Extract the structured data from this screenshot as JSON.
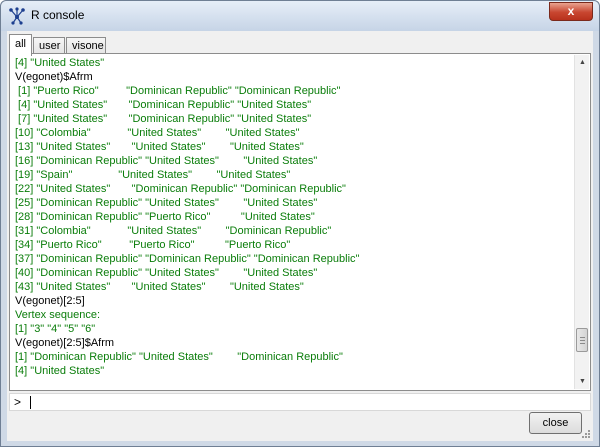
{
  "window": {
    "title": "R console",
    "close_glyph": "x",
    "icon": "network-graph-icon"
  },
  "tabs": [
    {
      "label": "all",
      "active": true
    },
    {
      "label": "user",
      "active": false
    },
    {
      "label": "visone",
      "active": false
    }
  ],
  "console": {
    "lines": [
      {
        "kind": "out",
        "text": "[4] \"United States\""
      },
      {
        "kind": "cmd",
        "text": "V(egonet)$Afrm"
      },
      {
        "kind": "out",
        "text": " [1] \"Puerto Rico\"         \"Dominican Republic\" \"Dominican Republic\""
      },
      {
        "kind": "out",
        "text": " [4] \"United States\"       \"Dominican Republic\" \"United States\""
      },
      {
        "kind": "out",
        "text": " [7] \"United States\"       \"Dominican Republic\" \"United States\""
      },
      {
        "kind": "out",
        "text": "[10] \"Colombia\"            \"United States\"        \"United States\""
      },
      {
        "kind": "out",
        "text": "[13] \"United States\"       \"United States\"        \"United States\""
      },
      {
        "kind": "out",
        "text": "[16] \"Dominican Republic\" \"United States\"        \"United States\""
      },
      {
        "kind": "out",
        "text": "[19] \"Spain\"               \"United States\"        \"United States\""
      },
      {
        "kind": "out",
        "text": "[22] \"United States\"       \"Dominican Republic\" \"Dominican Republic\""
      },
      {
        "kind": "out",
        "text": "[25] \"Dominican Republic\" \"United States\"        \"United States\""
      },
      {
        "kind": "out",
        "text": "[28] \"Dominican Republic\" \"Puerto Rico\"          \"United States\""
      },
      {
        "kind": "out",
        "text": "[31] \"Colombia\"            \"United States\"        \"Dominican Republic\""
      },
      {
        "kind": "out",
        "text": "[34] \"Puerto Rico\"         \"Puerto Rico\"          \"Puerto Rico\""
      },
      {
        "kind": "out",
        "text": "[37] \"Dominican Republic\" \"Dominican Republic\" \"Dominican Republic\""
      },
      {
        "kind": "out",
        "text": "[40] \"Dominican Republic\" \"United States\"        \"United States\""
      },
      {
        "kind": "out",
        "text": "[43] \"United States\"       \"United States\"        \"United States\""
      },
      {
        "kind": "cmd",
        "text": "V(egonet)[2:5]"
      },
      {
        "kind": "info",
        "text": "Vertex sequence:"
      },
      {
        "kind": "out",
        "text": "[1] \"3\" \"4\" \"5\" \"6\""
      },
      {
        "kind": "cmd",
        "text": "V(egonet)[2:5]$Afrm"
      },
      {
        "kind": "out",
        "text": "[1] \"Dominican Republic\" \"United States\"        \"Dominican Republic\""
      },
      {
        "kind": "out",
        "text": "[4] \"United States\""
      }
    ],
    "scroll_position": 0.92
  },
  "input": {
    "prompt": ">",
    "value": ""
  },
  "footer": {
    "close_label": "close"
  },
  "colors": {
    "output_text": "#0a7d0a",
    "command_text": "#000000",
    "window_frame": "#cfd9e6",
    "close_x_bg": "#c84630"
  }
}
